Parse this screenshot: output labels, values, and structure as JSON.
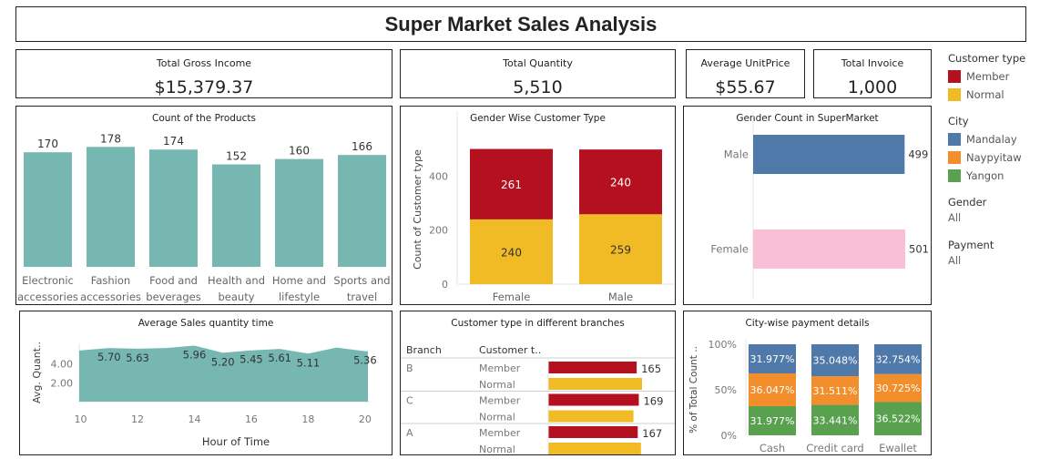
{
  "dashboard": {
    "title": "Super Market Sales Analysis"
  },
  "kpis": [
    {
      "label": "Total Gross Income",
      "value": "$15,379.37"
    },
    {
      "label": "Total Quantity",
      "value": "5,510"
    },
    {
      "label": "Average UnitPrice",
      "value": "$55.67"
    },
    {
      "label": "Total Invoice",
      "value": "1,000"
    }
  ],
  "legend": {
    "customer_type": {
      "title": "Customer type",
      "items": [
        {
          "label": "Member",
          "color": "#b5101f"
        },
        {
          "label": "Normal",
          "color": "#f0bb24"
        }
      ]
    },
    "city": {
      "title": "City",
      "items": [
        {
          "label": "Mandalay",
          "color": "#4f79a8"
        },
        {
          "label": "Naypyitaw",
          "color": "#f28e2b"
        },
        {
          "label": "Yangon",
          "color": "#59a14f"
        }
      ]
    },
    "gender": {
      "title": "Gender",
      "value": "All"
    },
    "payment": {
      "title": "Payment",
      "value": "All"
    }
  },
  "chart_data": [
    {
      "type": "bar",
      "title": "Count of the Products",
      "categories": [
        [
          "Electronic",
          "accessories"
        ],
        [
          "Fashion",
          "accessories"
        ],
        [
          "Food and",
          "beverages"
        ],
        [
          "Health and",
          "beauty"
        ],
        [
          "Home and",
          "lifestyle"
        ],
        [
          "Sports and",
          "travel"
        ]
      ],
      "values": [
        170,
        178,
        174,
        152,
        160,
        166
      ],
      "data_labels": [
        "170",
        "178",
        "174",
        "152",
        "160",
        "166"
      ],
      "color": "#76b7b2",
      "ylim": [
        0,
        200
      ]
    },
    {
      "type": "bar",
      "stacked": true,
      "title": "Gender Wise Customer Type",
      "categories": [
        "Female",
        "Male"
      ],
      "ylabel": "Count of Customer type",
      "yticks": [
        "0",
        "200",
        "400"
      ],
      "ylim": [
        0,
        540
      ],
      "series": [
        {
          "name": "Normal",
          "values": [
            240,
            259
          ],
          "labels": [
            "240",
            "259"
          ],
          "color": "#f0bb24"
        },
        {
          "name": "Member",
          "values": [
            261,
            240
          ],
          "labels": [
            "261",
            "240"
          ],
          "color": "#b5101f"
        }
      ]
    },
    {
      "type": "bar",
      "orientation": "horizontal",
      "title": "Gender Count in SuperMarket",
      "categories": [
        "Male",
        "Female"
      ],
      "values": [
        499,
        501
      ],
      "data_labels": [
        "499",
        "501"
      ],
      "colors": [
        "#4f79a8",
        "#f8bfd6"
      ],
      "xlim": [
        0,
        540
      ]
    },
    {
      "type": "area",
      "title": "Average Sales quantity time",
      "xlabel": "Hour of Time",
      "ylabel": "Avg. Quant..",
      "x": [
        10,
        11,
        12,
        13,
        14,
        15,
        16,
        17,
        18,
        19,
        20
      ],
      "y": [
        5.45,
        5.7,
        5.63,
        5.7,
        5.96,
        5.2,
        5.45,
        5.61,
        5.11,
        5.75,
        5.36
      ],
      "point_labels": [
        "",
        "5.70",
        "5.63",
        "",
        "5.96",
        "5.20",
        "5.45",
        "5.61",
        "5.11",
        "",
        "5.36"
      ],
      "xticks": [
        "10",
        "12",
        "14",
        "16",
        "18",
        "20"
      ],
      "yticks": [
        "2.00",
        "4.00"
      ],
      "ylim": [
        0,
        6.2
      ],
      "xlim": [
        9.95,
        20.1
      ],
      "color": "#76b7b2"
    },
    {
      "type": "bar",
      "orientation": "horizontal",
      "title": "Customer type in different branches",
      "column_headers": [
        "Branch",
        "Customer t.."
      ],
      "rows": [
        {
          "branch": "B",
          "member_label": "Member",
          "normal_label": "Normal",
          "member": 165,
          "normal": 175,
          "member_text": "165"
        },
        {
          "branch": "C",
          "member_label": "Member",
          "normal_label": "Normal",
          "member": 169,
          "normal": 159,
          "member_text": "169"
        },
        {
          "branch": "A",
          "member_label": "Member",
          "normal_label": "Normal",
          "member": 167,
          "normal": 173,
          "member_text": "167"
        }
      ],
      "xlim": [
        0,
        175
      ]
    },
    {
      "type": "bar",
      "stacked": true,
      "percent": true,
      "title": "City-wise payment details",
      "ylabel": "% of Total Count ..",
      "yticks": [
        "0%",
        "50%",
        "100%"
      ],
      "categories": [
        "Cash",
        "Credit card",
        "Ewallet"
      ],
      "series": [
        {
          "name": "Yangon",
          "values": [
            31.977,
            33.441,
            36.522
          ],
          "labels": [
            "31.977%",
            "33.441%",
            "36.522%"
          ],
          "color": "#59a14f"
        },
        {
          "name": "Naypyitaw",
          "values": [
            36.047,
            31.511,
            30.725
          ],
          "labels": [
            "36.047%",
            "31.511%",
            "30.725%"
          ],
          "color": "#f28e2b"
        },
        {
          "name": "Mandalay",
          "values": [
            31.977,
            35.048,
            32.754
          ],
          "labels": [
            "31.977%",
            "35.048%",
            "32.754%"
          ],
          "color": "#4f79a8"
        }
      ]
    }
  ]
}
